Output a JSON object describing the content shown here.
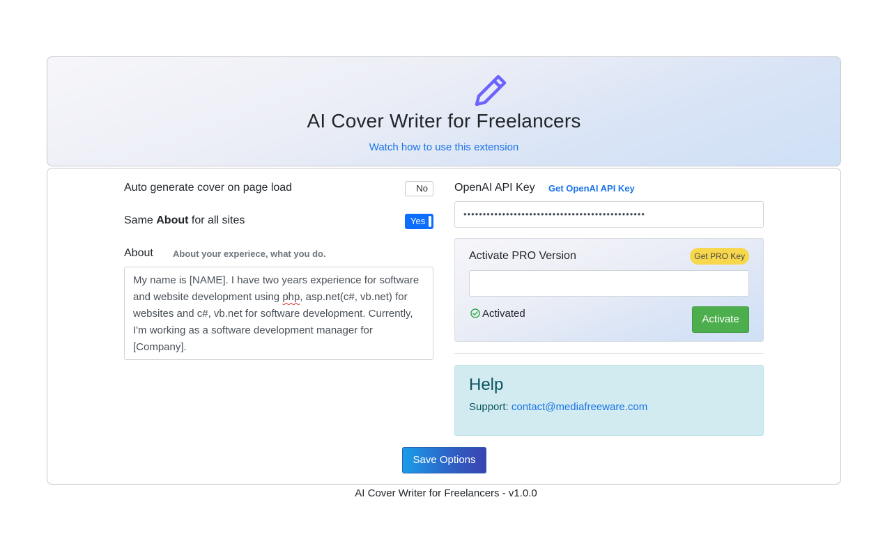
{
  "header": {
    "icon": "pencil-icon",
    "title": "AI Cover Writer for Freelancers",
    "help_link": "Watch how to use this extension"
  },
  "settings": {
    "auto_generate_label": "Auto generate cover on page load",
    "auto_generate_value": "No",
    "same_about_prefix": "Same ",
    "same_about_bold": "About",
    "same_about_suffix": " for all sites",
    "same_about_value": "Yes",
    "about_label": "About",
    "about_hint": "About your experiece, what you do.",
    "about_text_before": "My name is [NAME]. I have two years experience for software and website development using ",
    "about_text_misspelled": "php",
    "about_text_after": ", asp.net(c#, vb.net) for websites and c#, vb.net for software development. Currently, I'm working as a software development manager for [Company]."
  },
  "api": {
    "label": "OpenAI API Key",
    "link": "Get OpenAI API Key",
    "masked_value": "•••••••••••••••••••••••••••••••••••••••••••••••"
  },
  "pro": {
    "title": "Activate PRO Version",
    "badge": "Get PRO Key",
    "key_value": "",
    "status_icon": "check-circle-icon",
    "status": "Activated",
    "activate_button": "Activate"
  },
  "help": {
    "title": "Help",
    "support_label": "Support: ",
    "support_email": "contact@mediafreeware.com"
  },
  "save_button": "Save Options",
  "footer": "AI Cover Writer for Freelancers - v1.0.0",
  "colors": {
    "accent": "#6c63ff",
    "link": "#1a73e8",
    "toggle_on": "#0d6efd",
    "activate": "#4cae4c",
    "badge": "#f7d74b",
    "help_bg": "#d1ebf0"
  }
}
